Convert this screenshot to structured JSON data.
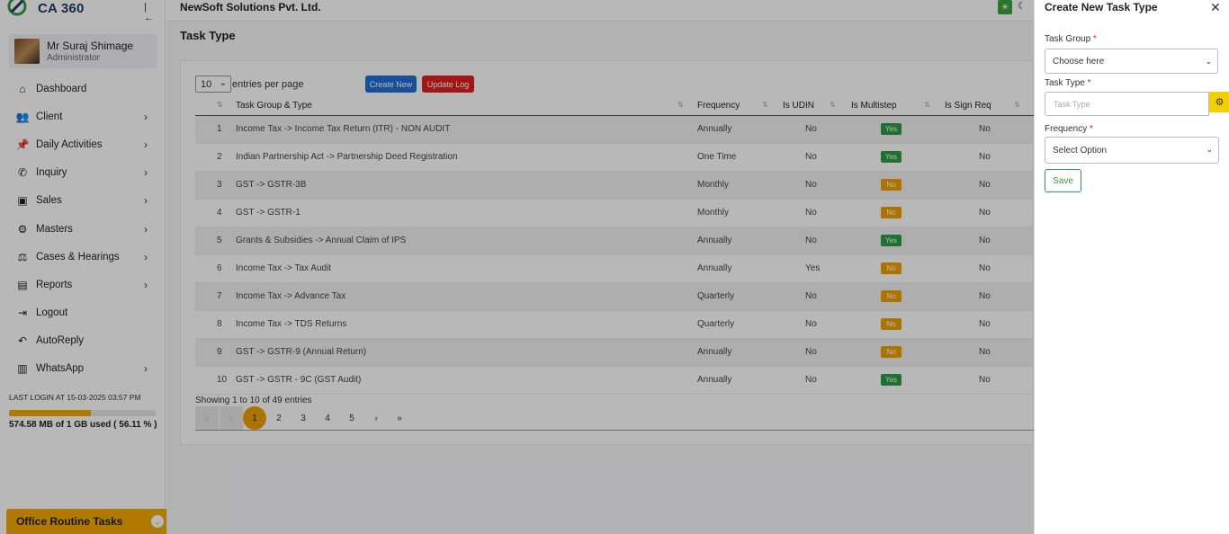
{
  "app": {
    "logo_text": "CA 360",
    "company": "NewSoft Solutions Pvt. Ltd."
  },
  "user": {
    "name": "Mr Suraj Shimage",
    "role": "Administrator"
  },
  "sidebar": {
    "items": [
      {
        "label": "Dashboard",
        "icon": "home-icon",
        "has_submenu": false
      },
      {
        "label": "Client",
        "icon": "users-icon",
        "has_submenu": true
      },
      {
        "label": "Daily Activities",
        "icon": "pin-icon",
        "has_submenu": true
      },
      {
        "label": "Inquiry",
        "icon": "phone-icon",
        "has_submenu": true
      },
      {
        "label": "Sales",
        "icon": "money-icon",
        "has_submenu": true
      },
      {
        "label": "Masters",
        "icon": "gears-icon",
        "has_submenu": true
      },
      {
        "label": "Cases & Hearings",
        "icon": "scale-icon",
        "has_submenu": true
      },
      {
        "label": "Reports",
        "icon": "file-icon",
        "has_submenu": true
      },
      {
        "label": "Logout",
        "icon": "logout-icon",
        "has_submenu": false
      },
      {
        "label": "AutoReply",
        "icon": "reply-icon",
        "has_submenu": false
      },
      {
        "label": "WhatsApp",
        "icon": "whatsapp-icon",
        "has_submenu": true
      }
    ],
    "last_login": "LAST LOGIN AT 15-03-2025 03:57 PM",
    "storage_text": "574.58 MB of 1 GB used ( 56.11 % )",
    "storage_fraction": 0.5611,
    "office_tasks_label": "Office Routine Tasks"
  },
  "main": {
    "page_title": "Task Type",
    "entries_value": "10",
    "entries_label": "entries per page",
    "create_new_label": "Create New",
    "update_log_label": "Update Log",
    "columns": [
      "Task Group & Type",
      "Frequency",
      "Is UDIN",
      "Is Multistep",
      "Is Sign Req"
    ],
    "rows": [
      {
        "no": "1",
        "task": "Income Tax -> Income Tax Return (ITR) - NON AUDIT",
        "frequency": "Annually",
        "udin": "No",
        "multistep": "Yes",
        "sign": "No"
      },
      {
        "no": "2",
        "task": "Indian Partnership Act -> Partnership Deed Registration",
        "frequency": "One Time",
        "udin": "No",
        "multistep": "Yes",
        "sign": "No"
      },
      {
        "no": "3",
        "task": "GST -> GSTR-3B",
        "frequency": "Monthly",
        "udin": "No",
        "multistep": "No",
        "sign": "No"
      },
      {
        "no": "4",
        "task": "GST -> GSTR-1",
        "frequency": "Monthly",
        "udin": "No",
        "multistep": "No",
        "sign": "No"
      },
      {
        "no": "5",
        "task": "Grants & Subsidies -> Annual Claim of IPS",
        "frequency": "Annually",
        "udin": "No",
        "multistep": "Yes",
        "sign": "No"
      },
      {
        "no": "6",
        "task": "Income Tax -> Tax Audit",
        "frequency": "Annually",
        "udin": "Yes",
        "multistep": "No",
        "sign": "No"
      },
      {
        "no": "7",
        "task": "Income Tax -> Advance Tax",
        "frequency": "Quarterly",
        "udin": "No",
        "multistep": "No",
        "sign": "No"
      },
      {
        "no": "8",
        "task": "Income Tax -> TDS Returns",
        "frequency": "Quarterly",
        "udin": "No",
        "multistep": "No",
        "sign": "No"
      },
      {
        "no": "9",
        "task": "GST -> GSTR-9 (Annual Return)",
        "frequency": "Annually",
        "udin": "No",
        "multistep": "No",
        "sign": "No"
      },
      {
        "no": "10",
        "task": "GST -> GSTR - 9C (GST Audit)",
        "frequency": "Annually",
        "udin": "No",
        "multistep": "Yes",
        "sign": "No"
      }
    ],
    "showing_text": "Showing 1 to 10 of 49 entries",
    "pager": {
      "first": "«",
      "prev": "‹",
      "pages": [
        "1",
        "2",
        "3",
        "4",
        "5"
      ],
      "active_page": "1",
      "next": "›",
      "last": "»"
    }
  },
  "panel": {
    "title": "Create New Task Type",
    "close": "✕",
    "task_group_label": "Task Group",
    "task_group_value": "Choose here",
    "task_type_label": "Task Type",
    "task_type_placeholder": "Task Type",
    "frequency_label": "Frequency",
    "frequency_value": "Select Option",
    "required_marker": "*",
    "save_label": "Save"
  },
  "colors": {
    "accent": "#f4a800",
    "create_button": "#1f6fd6",
    "update_log_button": "#e02020",
    "yes_badge": "#2e9b45",
    "no_badge": "#f0a000"
  }
}
